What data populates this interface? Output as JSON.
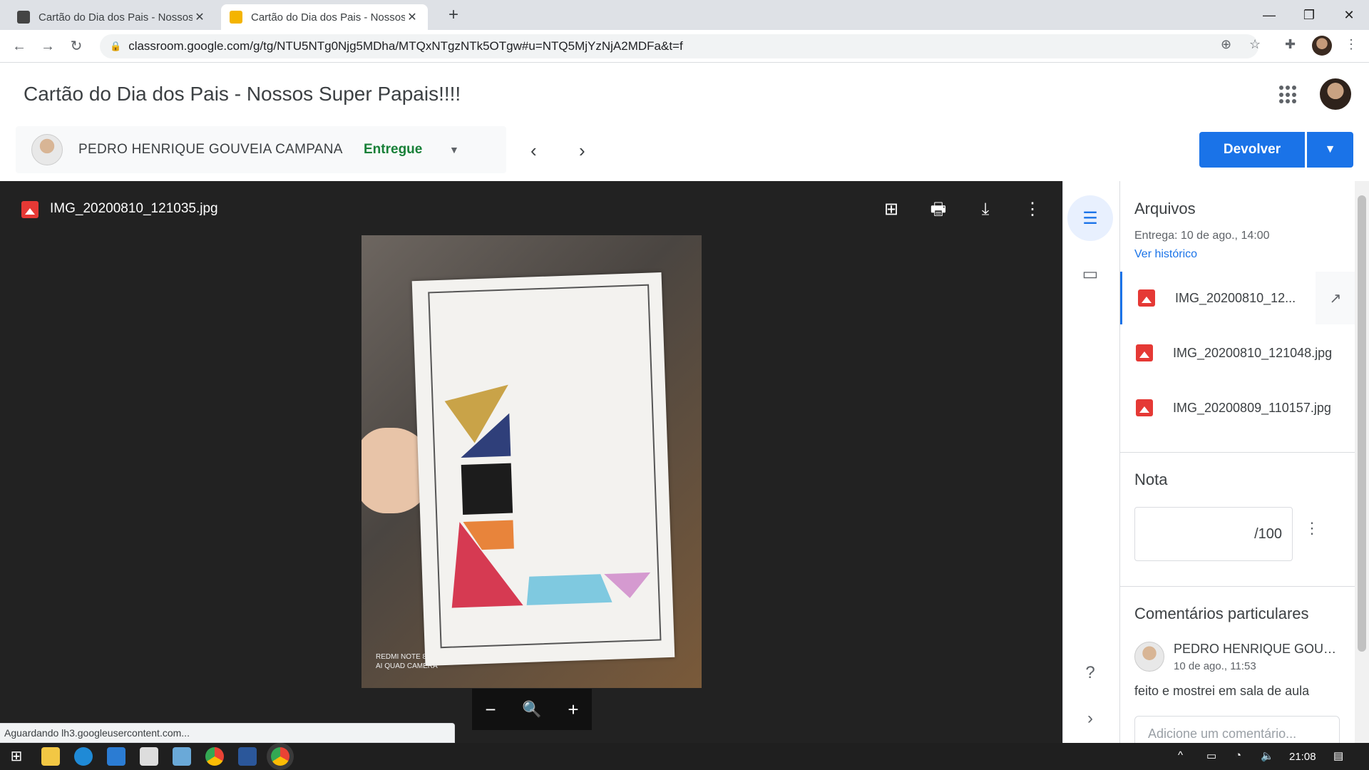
{
  "browser": {
    "tabs": [
      {
        "title": "Cartão do Dia dos Pais - Nossos Super Papais!!!!",
        "active": false
      },
      {
        "title": "Cartão do Dia dos Pais - Nossos Super Papais!!!!",
        "active": true
      }
    ],
    "url": "classroom.google.com/g/tg/NTU5NTg0Njg5MDha/MTQxNTgzNTk5OTgw#u=NTQ5MjYzNjA2MDFa&t=f",
    "status_text": "Aguardando lh3.googleusercontent.com..."
  },
  "header": {
    "title": "Cartão do Dia dos Pais - Nossos Super Papais!!!!"
  },
  "student": {
    "name": "PEDRO HENRIQUE GOUVEIA CAMPANA",
    "status": "Entregue"
  },
  "actions": {
    "return_label": "Devolver"
  },
  "viewer": {
    "file_name": "IMG_20200810_121035.jpg",
    "camera_watermark": [
      "REDMI NOTE 8",
      "AI QUAD CAMERA"
    ]
  },
  "panel": {
    "files_title": "Arquivos",
    "delivery": "Entrega: 10 de ago., 14:00",
    "history_link": "Ver histórico",
    "files": [
      {
        "name": "IMG_20200810_12...",
        "selected": true
      },
      {
        "name": "IMG_20200810_121048.jpg",
        "selected": false
      },
      {
        "name": "IMG_20200809_110157.jpg",
        "selected": false
      }
    ],
    "grade_title": "Nota",
    "grade_suffix": "/100",
    "comments_title": "Comentários particulares",
    "comment": {
      "author": "PEDRO HENRIQUE GOUVEIA CAMPANA",
      "date": "10 de ago., 11:53",
      "text": "feito e mostrei em sala de aula"
    },
    "comment_placeholder": "Adicione um comentário..."
  },
  "taskbar": {
    "time": "21:08"
  },
  "colors": {
    "accent": "#1a73e8",
    "status_green": "#188038",
    "file_icon_red": "#e53935",
    "viewer_bg": "#222222"
  }
}
